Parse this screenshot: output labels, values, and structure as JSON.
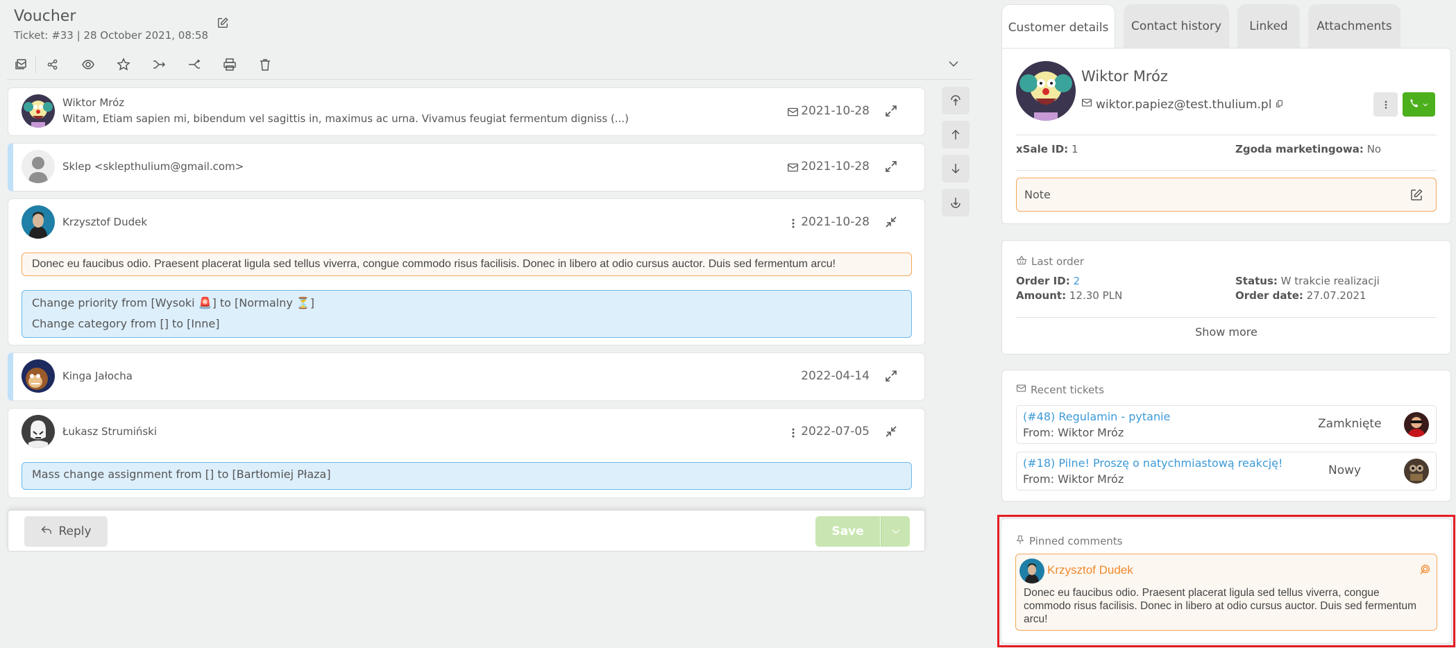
{
  "header": {
    "title": "Voucher",
    "subtitle": "Ticket: #33 | 28 October 2021, 08:58"
  },
  "toolbar": {
    "icons": [
      "mail-stack-icon",
      "share-icon",
      "eye-icon",
      "star-icon",
      "merge-icon",
      "split-icon",
      "print-icon",
      "trash-icon"
    ]
  },
  "messages": [
    {
      "author": "Wiktor Mróz",
      "preview": "Witam, Etiam sapien mi, bibendum vel sagittis in, maximus ac urna. Vivamus feugiat fermentum digniss (...)",
      "date": "2021-10-28",
      "channel_icon": "mail-icon",
      "expanded": false
    },
    {
      "author": "Sklep <sklepthulium@gmail.com>",
      "date": "2021-10-28",
      "channel_icon": "mail-icon",
      "expanded": false
    },
    {
      "author": "Krzysztof Dudek",
      "date": "2021-10-28",
      "expanded": true,
      "comment": "Donec eu faucibus odio. Praesent placerat ligula sed tellus viverra, congue commodo risus facilisis. Donec in libero at odio cursus auctor. Duis sed fermentum arcu!",
      "changes": [
        "Change priority from [Wysoki 🚨] to [Normalny ⏳]",
        "Change category from [] to [Inne]"
      ]
    },
    {
      "author": "Kinga Jałocha",
      "date": "2022-04-14",
      "expanded": false
    },
    {
      "author": "Łukasz Strumiński",
      "date": "2022-07-05",
      "expanded": true,
      "changes": [
        "Mass change assignment from [] to [Bartłomiej Płaza]"
      ]
    }
  ],
  "actions": {
    "reply_label": "Reply",
    "save_label": "Save"
  },
  "tabs": [
    {
      "label": "Customer details",
      "active": true
    },
    {
      "label": "Contact history",
      "active": false
    },
    {
      "label": "Linked",
      "active": false
    },
    {
      "label": "Attachments",
      "active": false
    }
  ],
  "customer": {
    "name": "Wiktor Mróz",
    "email": "wiktor.papiez@test.thulium.pl",
    "xsale_label": "xSale ID:",
    "xsale_value": "1",
    "consent_label": "Zgoda marketingowa:",
    "consent_value": "No",
    "note_label": "Note"
  },
  "last_order": {
    "title": "Last order",
    "order_id_label": "Order ID:",
    "order_id": "2",
    "amount_label": "Amount:",
    "amount": "12.30 PLN",
    "status_label": "Status:",
    "status": "W trakcie realizacji",
    "date_label": "Order date:",
    "date": "27.07.2021",
    "show_more": "Show more"
  },
  "recent_tickets": {
    "title": "Recent tickets",
    "items": [
      {
        "title": "(#48) Regulamin - pytanie",
        "from": "From: Wiktor Mróz",
        "status": "Zamknięte"
      },
      {
        "title": "(#18) Pilne! Proszę o natychmiastową reakcję!",
        "from": "From: Wiktor Mróz",
        "status": "Nowy"
      }
    ]
  },
  "pinned": {
    "title": "Pinned comments",
    "author": "Krzysztof Dudek",
    "text": "Donec eu faucibus odio. Praesent placerat ligula sed tellus viverra, congue commodo risus facilisis. Donec in libero at odio cursus auctor. Duis sed fermentum arcu!"
  },
  "colors": {
    "accent_blue": "#3d9ad8",
    "call_green": "#4caf1c",
    "save_green_disabled": "#c9e6b2",
    "note_orange": "#f3a85b",
    "pinned_name_orange": "#f08a2c",
    "highlight_red": "#e51c23"
  }
}
